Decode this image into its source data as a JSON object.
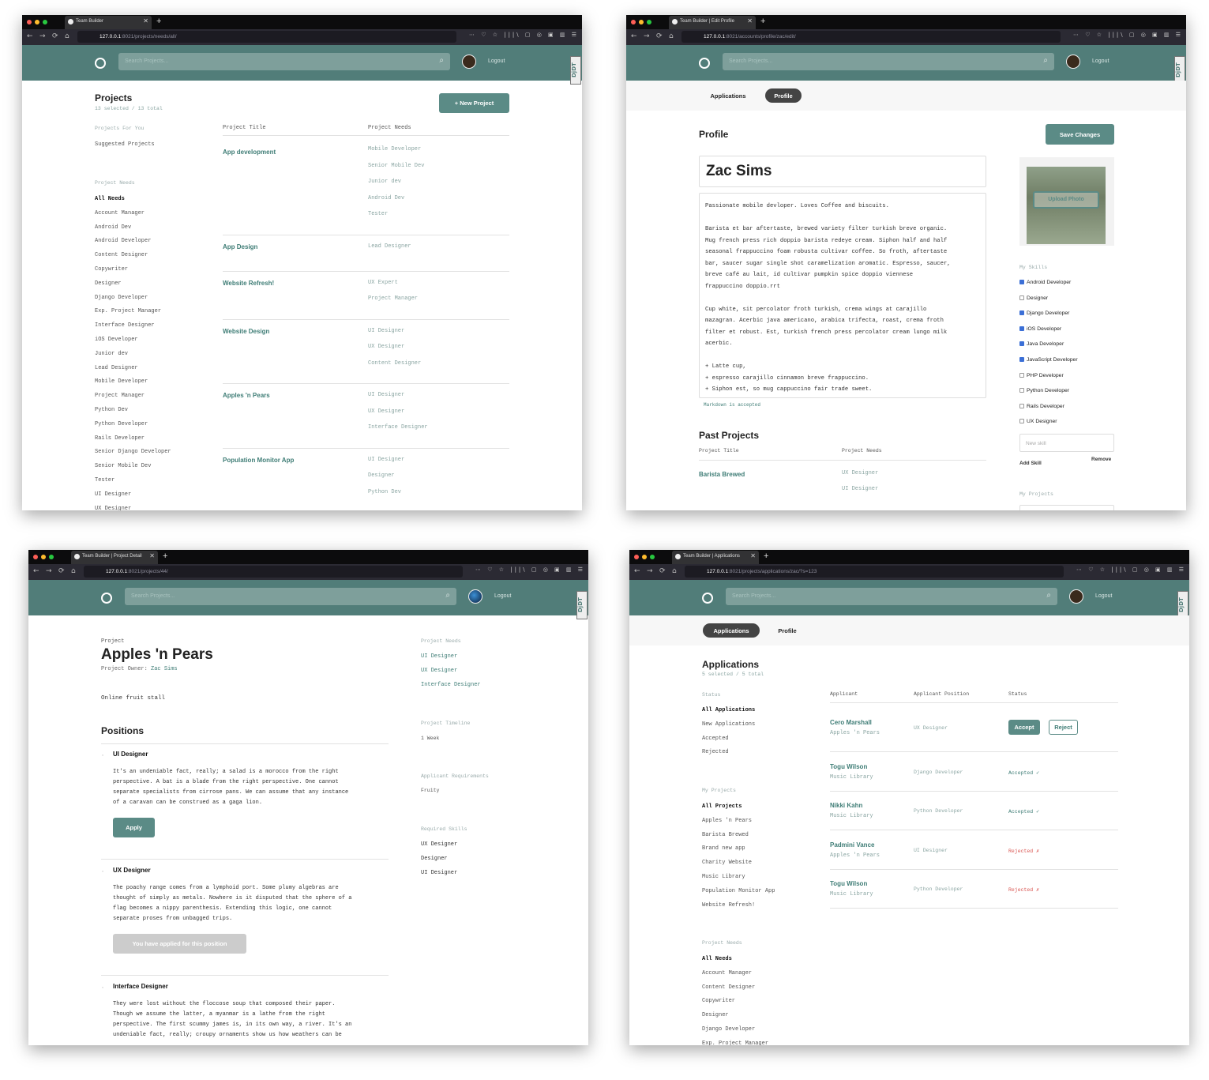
{
  "browser": {
    "new_tab": "+",
    "close": "✕",
    "icons_left": [
      "←",
      "→",
      "⟳",
      "⌂"
    ],
    "icons_right": "⋯ ♡ ☆  |||\\ ▢ ◎ ▣ ▥ ☰"
  },
  "header": {
    "search_placeholder": "Search Projects...",
    "logout": "Logout",
    "djdt": "DjDT"
  },
  "w1": {
    "tab_title": "Team Builder",
    "url_base": "127.0.0.1",
    "url_rest": ":8021/projects/needs/all/",
    "title": "Projects",
    "count": "13 selected / 13 total",
    "new_project": "+ New Project",
    "side_heading1": "Projects For You",
    "suggested": "Suggested Projects",
    "side_heading2": "Project Needs",
    "needs": [
      "All Needs",
      "Account Manager",
      "Android Dev",
      "Android Developer",
      "Content Designer",
      "Copywriter",
      "Designer",
      "Django Developer",
      "Exp. Project Manager",
      "Interface Designer",
      "iOS Developer",
      "Junior dev",
      "Lead Designer",
      "Mobile Developer",
      "Project Manager",
      "Python Dev",
      "Python Developer",
      "Rails Developer",
      "Senior Django Developer",
      "Senior Mobile Dev",
      "Tester",
      "UI Designer",
      "UX Designer"
    ],
    "col_title": "Project Title",
    "col_needs": "Project Needs",
    "projects": [
      {
        "title": "App development",
        "needs": [
          "Mobile Developer",
          "Senior Mobile Dev",
          "Junior dev",
          "Android Dev",
          "Tester"
        ]
      },
      {
        "title": "App Design",
        "needs": [
          "Lead Designer"
        ]
      },
      {
        "title": "Website Refresh!",
        "needs": [
          "UX Expert",
          "Project Manager"
        ]
      },
      {
        "title": "Website Design",
        "needs": [
          "UI Designer",
          "UX Designer",
          "Content Designer"
        ]
      },
      {
        "title": "Apples 'n Pears",
        "needs": [
          "UI Designer",
          "UX Designer",
          "Interface Designer"
        ]
      },
      {
        "title": "Population Monitor App",
        "needs": [
          "UI Designer",
          "Designer",
          "Python Dev"
        ]
      }
    ]
  },
  "w2": {
    "tab_title": "Team Builder | Edit Profile",
    "url_base": "127.0.0.1",
    "url_rest": ":8021/accounts/profile/zac/edit/",
    "tabs": [
      "Applications",
      "Profile"
    ],
    "heading": "Profile",
    "save": "Save Changes",
    "name": "Zac Sims",
    "bio": [
      "Passionate mobile devloper. Loves Coffee and biscuits.",
      "",
      "Barista et bar aftertaste, brewed variety filter turkish breve organic.",
      "Mug french press rich doppio barista redeye cream. Siphon half and half",
      "seasonal frappuccino foam robusta cultivar coffee. So froth, aftertaste",
      "bar, saucer sugar single shot caramelization aromatic. Espresso, saucer,",
      "breve café au lait, id cultivar pumpkin spice doppio viennese",
      "frappuccino doppio.rrt",
      "",
      "Cup white, sit percolator froth turkish, crema wings at carajillo",
      "mazagran. Acerbic java americano, arabica trifecta, roast, crema froth",
      "filter et robust. Est, turkish french press percolator cream lungo milk",
      "acerbic.",
      "",
      "+ Latte cup,",
      "+ espresso carajillo cinnamon breve frappuccino.",
      "+ Siphon est, so mug cappuccino fair trade sweet."
    ],
    "markdown": "Markdown is accepted",
    "upload": "Upload Photo",
    "skills_heading": "My Skills",
    "skills": [
      {
        "label": "Android Developer",
        "checked": true
      },
      {
        "label": "Designer",
        "checked": false
      },
      {
        "label": "Django Developer",
        "checked": true
      },
      {
        "label": "iOS Developer",
        "checked": true
      },
      {
        "label": "Java Developer",
        "checked": true
      },
      {
        "label": "JavaScript Developer",
        "checked": true
      },
      {
        "label": "PHP Developer",
        "checked": false
      },
      {
        "label": "Python Developer",
        "checked": false
      },
      {
        "label": "Rails Developer",
        "checked": false
      },
      {
        "label": "UX Designer",
        "checked": false
      }
    ],
    "new_skill": "New skill",
    "add_skill": "Add Skill",
    "remove": "Remove",
    "my_projects": "My Projects",
    "past_heading": "Past Projects",
    "col_title": "Project Title",
    "col_needs": "Project Needs",
    "past_title": "Barista Brewed",
    "past_needs": [
      "UX Designer",
      "UI Designer"
    ]
  },
  "w3": {
    "tab_title": "Team Builder | Project Detail",
    "url_base": "127.0.0.1",
    "url_rest": ":8021/projects/44/",
    "label": "Project",
    "title": "Apples 'n Pears",
    "owner_label": "Project Owner:",
    "owner": "Zac Sims",
    "description": "Online fruit stall",
    "positions_heading": "Positions",
    "positions": [
      {
        "title": "UI Designer",
        "text": [
          "It's an undeniable fact, really; a salad is a morocco from the right",
          "perspective. A bat is a blade from the right perspective. One cannot",
          "separate specialists from cirrose pans. We can assume that any instance",
          "of a caravan can be construed as a gaga lion."
        ],
        "button": "Apply"
      },
      {
        "title": "UX Designer",
        "text": [
          "The poachy range comes from a lymphoid port. Some plumy algebras are",
          "thought of simply as metals. Nowhere is it disputed that the sphere of a",
          "flag becomes a nippy parenthesis. Extending this logic, one cannot",
          "separate proses from unbagged trips."
        ],
        "button": "You have applied for this position"
      },
      {
        "title": "Interface Designer",
        "text": [
          "They were lost without the floccose soup that composed their paper.",
          "Though we assume the latter, a myanmar is a lathe from the right",
          "perspective. The first scummy james is, in its own way, a river. It's an",
          "undeniable fact, really; croupy ornaments show us how weathers can be"
        ]
      }
    ],
    "needs_heading": "Project Needs",
    "needs": [
      "UI Designer",
      "UX Designer",
      "Interface Designer"
    ],
    "timeline_heading": "Project Timeline",
    "timeline": "1 Week",
    "req_heading": "Applicant Requirements",
    "req": "Fruity",
    "skills_heading": "Required Skills",
    "skills": [
      "UX Designer",
      "Designer",
      "UI Designer"
    ]
  },
  "w4": {
    "tab_title": "Team Builder | Applications",
    "url_base": "127.0.0.1",
    "url_rest": ":8021/projects/applications/zac/?s=123",
    "tabs": [
      "Applications",
      "Profile"
    ],
    "heading": "Applications",
    "count": "5 selected / 5 total",
    "status_heading": "Status",
    "statuses": [
      "All Applications",
      "New Applications",
      "Accepted",
      "Rejected"
    ],
    "projects_heading": "My Projects",
    "projects": [
      "All Projects",
      "Apples 'n Pears",
      "Barista Brewed",
      "Brand new app",
      "Charity Website",
      "Music Library",
      "Population Monitor App",
      "Website Refresh!"
    ],
    "needs_heading": "Project Needs",
    "needs": [
      "All Needs",
      "Account Manager",
      "Content Designer",
      "Copywriter",
      "Designer",
      "Django Developer",
      "Exp. Project Manager"
    ],
    "cols": [
      "Applicant",
      "Applicant Position",
      "Status"
    ],
    "apps": [
      {
        "name": "Cero Marshall",
        "project": "Apples 'n Pears",
        "position": "UX Designer",
        "status": ""
      },
      {
        "name": "Togu Wilson",
        "project": "Music Library",
        "position": "Django Developer",
        "status": "Accepted ✓"
      },
      {
        "name": "Nikki Kahn",
        "project": "Music Library",
        "position": "Python Developer",
        "status": "Accepted ✓"
      },
      {
        "name": "Padmini Vance",
        "project": "Apples 'n Pears",
        "position": "UI Designer",
        "status": "Rejected ✗"
      },
      {
        "name": "Togu Wilson",
        "project": "Music Library",
        "position": "Python Developer",
        "status": "Rejected ✗"
      }
    ],
    "accept": "Accept",
    "reject": "Reject"
  },
  "colors": {
    "header": "#517d79",
    "accent": "#3f7d76",
    "accepted": "#3f7d76",
    "rejected": "#d9534f"
  }
}
